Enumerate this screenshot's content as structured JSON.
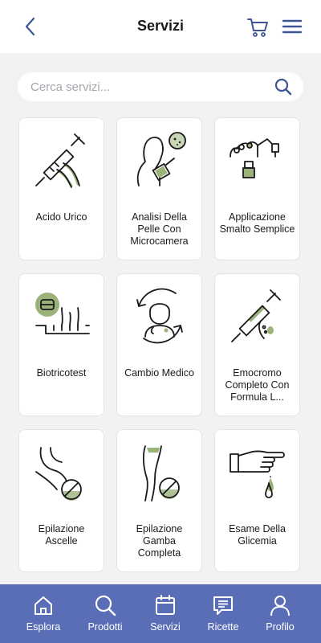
{
  "header": {
    "title": "Servizi"
  },
  "search": {
    "placeholder": "Cerca servizi..."
  },
  "services": [
    {
      "label": "Acido Urico",
      "icon": "syringe-knee-icon"
    },
    {
      "label": "Analisi Della Pelle Con Microcamera",
      "icon": "skin-microcamera-icon"
    },
    {
      "label": "Applicazione Smalto Semplice",
      "icon": "nail-polish-icon"
    },
    {
      "label": "Biotricotest",
      "icon": "hair-follicle-icon"
    },
    {
      "label": "Cambio Medico",
      "icon": "doctor-change-icon"
    },
    {
      "label": "Emocromo Completo Con Formula L...",
      "icon": "blood-syringe-icon"
    },
    {
      "label": "Epilazione Ascelle",
      "icon": "armpit-epilation-icon"
    },
    {
      "label": "Epilazione Gamba Completa",
      "icon": "leg-epilation-icon"
    },
    {
      "label": "Esame Della Glicemia",
      "icon": "glucose-finger-icon"
    }
  ],
  "bottom_nav": [
    {
      "label": "Esplora",
      "icon": "home-icon"
    },
    {
      "label": "Prodotti",
      "icon": "search-icon"
    },
    {
      "label": "Servizi",
      "icon": "calendar-icon"
    },
    {
      "label": "Ricette",
      "icon": "prescription-icon"
    },
    {
      "label": "Profilo",
      "icon": "user-icon"
    }
  ],
  "colors": {
    "accent": "#3d5596",
    "nav_bg": "#5a6eb8",
    "illustration_green": "#9bb37a",
    "background": "#f2f2f4"
  }
}
